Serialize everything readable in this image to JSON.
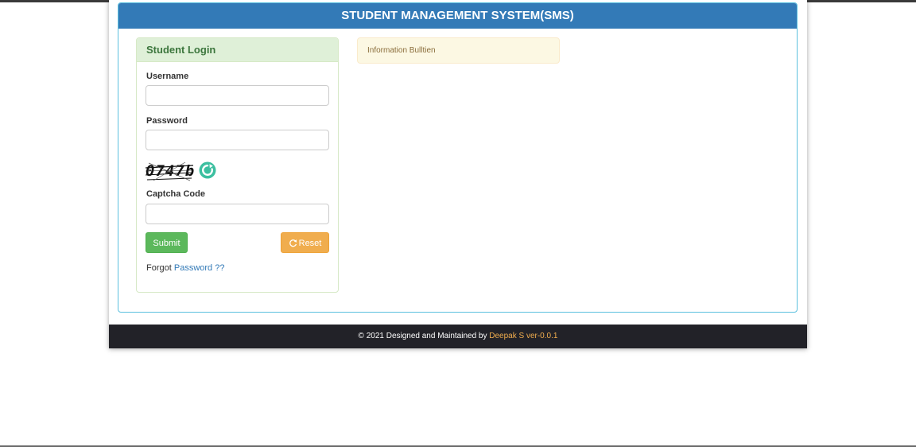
{
  "header": {
    "title": "STUDENT MANAGEMENT SYSTEM(SMS)"
  },
  "login": {
    "heading": "Student Login",
    "username_label": "Username",
    "username_value": "",
    "password_label": "Password",
    "password_value": "",
    "captcha_text": "0747b",
    "captcha_label": "Captcha Code",
    "captcha_value": "",
    "submit_label": "Submit",
    "reset_label": "Reset",
    "forgot_text": "Forgot",
    "forgot_link": "Password ??"
  },
  "info": {
    "heading": "Information Bulltien"
  },
  "footer": {
    "text": "© 2021 Designed and Maintained by",
    "author": "Deepak S ver-0.0.1"
  },
  "icons": {
    "refresh": "refresh-icon",
    "reset": "refresh-icon"
  },
  "colors": {
    "primary": "#337ab7",
    "success": "#5cb85c",
    "warning": "#f0ad4e",
    "captcha_refresh": "#3cbfa0",
    "footer_bg": "#222228"
  }
}
